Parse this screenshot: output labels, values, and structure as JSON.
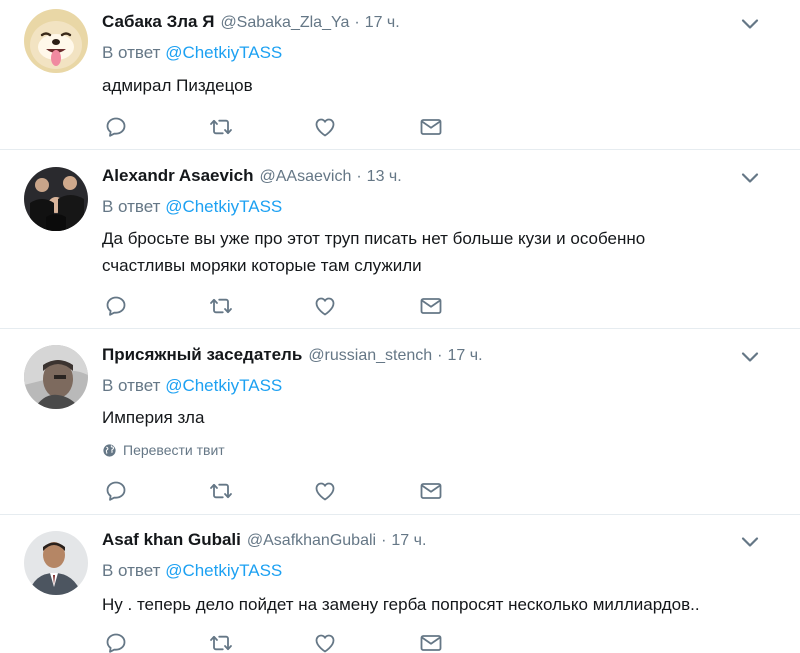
{
  "reply_prefix": "В ответ",
  "icons": {
    "reply": "reply-icon",
    "retweet": "retweet-icon",
    "like": "heart-icon",
    "dm": "envelope-icon",
    "caret": "chevron-down-icon",
    "globe": "globe-icon"
  },
  "colors": {
    "link": "#1da1f2",
    "secondary_text": "#657786",
    "primary_text": "#14171a",
    "icon": "#657786",
    "divider": "#e6ecf0"
  },
  "tweets": [
    {
      "name": "Сабака Зла Я",
      "handle": "@Sabaka_Zla_Ya",
      "separator": "·",
      "time": "17 ч.",
      "reply_to": "@ChetkiyTASS",
      "text": "адмирал Пиздецов",
      "avatar": "dog-avatar"
    },
    {
      "name": "Alexandr Asaevich",
      "handle": "@AAsaevich",
      "separator": "·",
      "time": "13 ч.",
      "reply_to": "@ChetkiyTASS",
      "text_lines": [
        "Да бросьте вы уже про этот труп писать нет больше кузи и особенно",
        "счастливы моряки которые там служили"
      ],
      "avatar": "group-photo-avatar"
    },
    {
      "name": "Присяжный заседатель",
      "handle": "@russian_stench",
      "separator": "·",
      "time": "17 ч.",
      "reply_to": "@ChetkiyTASS",
      "text": "Империя зла",
      "translate_label": "Перевести твит",
      "avatar": "man-portrait-avatar"
    },
    {
      "name": "Asaf khan Gubali",
      "handle": "@AsafkhanGubali",
      "separator": "·",
      "time": "17 ч.",
      "reply_to": "@ChetkiyTASS",
      "text": "Ну . теперь дело пойдет на замену герба попросят несколько миллиардов..",
      "avatar": "man-suit-avatar"
    }
  ]
}
